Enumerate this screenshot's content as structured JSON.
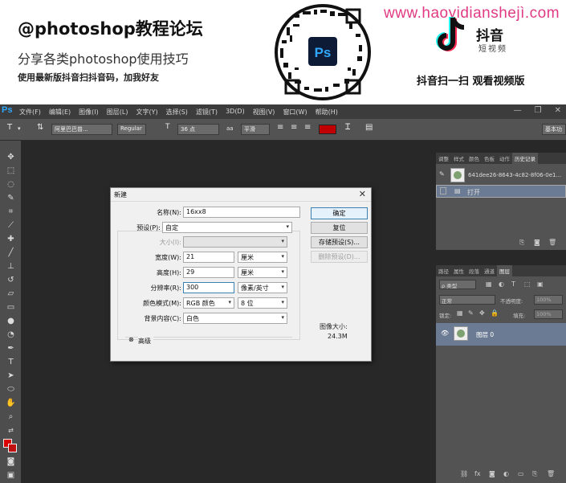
{
  "banner": {
    "title": "@photoshop教程论坛",
    "subtitle": "分享各类photoshop使用技巧",
    "tagline": "使用最新版抖音扫抖音码，加我好友",
    "qr_label": "Ps",
    "url": "www.haoyidianshejì.com",
    "tiktok_name": "抖音",
    "tiktok_sub": "短视频",
    "cta": "抖音扫一扫 观看视频版"
  },
  "menubar": {
    "logo": "Ps",
    "items": [
      "文件(F)",
      "编辑(E)",
      "图像(I)",
      "图层(L)",
      "文字(Y)",
      "选择(S)",
      "滤镜(T)",
      "3D(D)",
      "视图(V)",
      "窗口(W)",
      "帮助(H)"
    ],
    "controls": [
      "—",
      "❐",
      "✕"
    ]
  },
  "options": {
    "tool_icon": "T",
    "font_family": "阿里巴巴普...",
    "font_style": "Regular",
    "font_size": "36 点",
    "aa_label": "aa",
    "aa_mode": "平滑",
    "workspace": "基本功"
  },
  "history_panel": {
    "tabs": [
      "调整",
      "样式",
      "颜色",
      "色板",
      "动作",
      "历史记录"
    ],
    "snapshot_name": "641dee26-8643-4c82-8f06-0e1...",
    "steps": [
      "打开"
    ]
  },
  "layers_panel": {
    "tabs": [
      "路径",
      "属性",
      "段落",
      "通道",
      "图层"
    ],
    "filter_label": "ρ 类型",
    "blend_mode": "正常",
    "opacity_label": "不透明度:",
    "opacity_value": "100%",
    "lock_label": "锁定:",
    "fill_label": "填充:",
    "fill_value": "100%",
    "layer_name": "图层 0"
  },
  "dialog": {
    "title": "新建",
    "name_label": "名称(N):",
    "name_value": "16xx8",
    "preset_label": "预设(P):",
    "preset_value": "自定",
    "size_label": "大小(I):",
    "width_label": "宽度(W):",
    "width_value": "21",
    "width_unit": "厘米",
    "height_label": "高度(H):",
    "height_value": "29",
    "height_unit": "厘米",
    "resolution_label": "分辨率(R):",
    "resolution_value": "300",
    "resolution_unit": "像素/英寸",
    "color_mode_label": "颜色模式(M):",
    "color_mode_value": "RGB 颜色",
    "bit_depth": "8 位",
    "background_label": "背景内容(C):",
    "background_value": "白色",
    "advanced_label": "高级",
    "ok": "确定",
    "reset": "复位",
    "save_preset": "存储预设(S)...",
    "delete_preset": "删除预设(D)...",
    "image_size_label": "图像大小:",
    "image_size_value": "24.3M"
  },
  "colors": {
    "accent_red": "#c00000",
    "url_pink": "#e03a83",
    "selection_blue": "#6b7b93",
    "ps_blue": "#30a8ff"
  }
}
